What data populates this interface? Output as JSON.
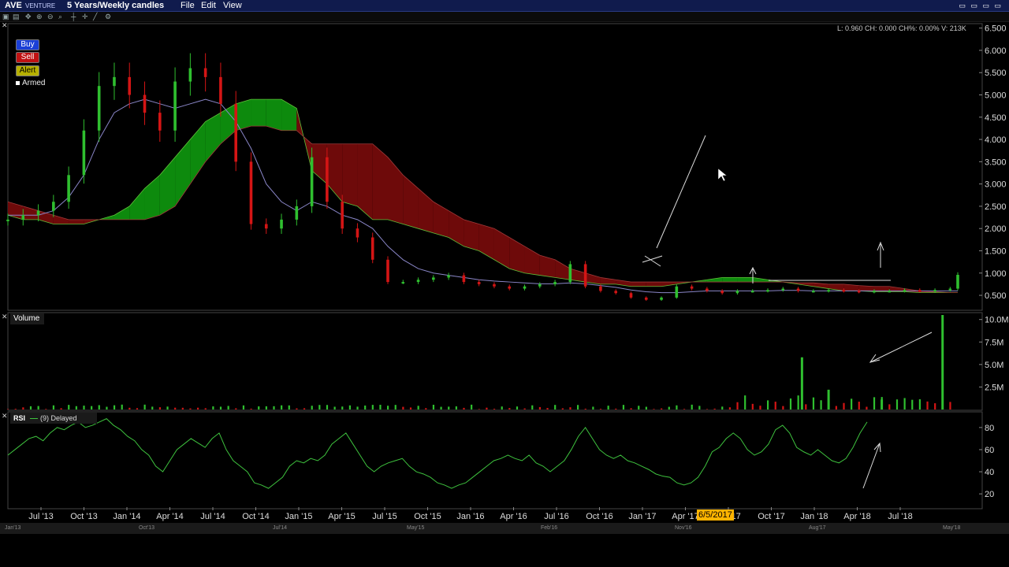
{
  "header": {
    "ticker": "AVE",
    "exchange": "VENTURE",
    "period": "5 Years/Weekly candles",
    "menu": [
      "File",
      "Edit",
      "View"
    ]
  },
  "buttons": {
    "buy": "Buy",
    "sell": "Sell",
    "alert": "Alert",
    "armed": "Armed"
  },
  "info_line": "L: 0.960 CH: 0.000 CH%: 0.00% V: 213K",
  "volume_label": "Volume",
  "rsi_label": {
    "name": "RSI",
    "params": "(9) Delayed"
  },
  "highlight_date": "6/5/2017",
  "bottom_nav": [
    "Jan'13",
    "Oct'13",
    "Jul'14",
    "May'15",
    "Feb'16",
    "Nov'16",
    "Aug'17",
    "May'18"
  ],
  "colors": {
    "up": "#2fbf2f",
    "down": "#d41515",
    "cloud_bull": "#0d8a0d",
    "cloud_bear": "#6e0a0a",
    "ma": "#8a86c8",
    "rsi": "#3ec23e"
  },
  "chart_data": [
    {
      "type": "line",
      "name": "price",
      "x_ticks": [
        "Jul '13",
        "Oct '13",
        "Jan '14",
        "Apr '14",
        "Jul '14",
        "Oct '14",
        "Jan '15",
        "Apr '15",
        "Jul '15",
        "Oct '15",
        "Jan '16",
        "Apr '16",
        "Jul '16",
        "Oct '16",
        "Jan '17",
        "Apr '17",
        "Jul '17",
        "Oct '17",
        "Jan '18",
        "Apr '18",
        "Jul '18"
      ],
      "y_ticks": [
        "0.500",
        "1.000",
        "1.500",
        "2.000",
        "2.500",
        "3.000",
        "3.500",
        "4.000",
        "4.500",
        "5.000",
        "5.500",
        "6.000",
        "6.500"
      ],
      "ylim": [
        0.2,
        6.6
      ],
      "x": [
        0,
        4,
        8,
        12,
        16,
        20,
        24,
        28,
        32,
        36,
        40,
        44,
        48,
        52,
        56,
        60,
        64,
        68,
        72,
        76,
        80,
        84,
        88,
        92,
        96,
        100,
        104,
        108,
        112,
        116,
        120,
        124,
        128,
        132,
        136,
        140,
        144,
        148,
        152,
        156,
        160,
        164,
        168,
        172,
        176,
        180,
        184,
        188,
        192,
        196,
        200,
        204,
        208,
        212,
        216,
        220,
        224,
        228,
        232,
        236,
        240,
        244,
        248,
        250
      ],
      "close": [
        2.2,
        2.3,
        2.4,
        2.6,
        3.2,
        4.2,
        5.2,
        5.4,
        5.0,
        4.6,
        4.2,
        5.3,
        5.6,
        5.4,
        4.8,
        3.5,
        2.1,
        2.0,
        2.2,
        2.5,
        3.6,
        2.6,
        2.0,
        1.8,
        1.3,
        0.8,
        0.8,
        0.85,
        0.9,
        0.95,
        0.8,
        0.75,
        0.7,
        0.65,
        0.7,
        0.75,
        0.8,
        1.2,
        0.7,
        0.6,
        0.55,
        0.45,
        0.4,
        0.45,
        0.7,
        0.65,
        0.6,
        0.55,
        0.6,
        0.6,
        0.62,
        0.65,
        0.6,
        0.6,
        0.62,
        0.6,
        0.58,
        0.6,
        0.6,
        0.62,
        0.6,
        0.62,
        0.65,
        0.96
      ],
      "kijun": [
        2.3,
        2.3,
        2.3,
        2.4,
        2.7,
        3.2,
        4.0,
        4.6,
        4.8,
        4.9,
        4.8,
        4.7,
        4.8,
        4.9,
        4.8,
        4.4,
        3.8,
        3.0,
        2.6,
        2.4,
        2.6,
        2.5,
        2.3,
        2.2,
        2.0,
        1.6,
        1.3,
        1.1,
        1.0,
        0.95,
        0.9,
        0.85,
        0.82,
        0.8,
        0.78,
        0.76,
        0.76,
        0.78,
        0.76,
        0.72,
        0.68,
        0.62,
        0.58,
        0.56,
        0.56,
        0.58,
        0.6,
        0.6,
        0.6,
        0.6,
        0.6,
        0.61,
        0.61,
        0.6,
        0.6,
        0.6,
        0.6,
        0.6,
        0.6,
        0.6,
        0.6,
        0.6,
        0.6,
        0.6
      ],
      "cloud_a": [
        2.3,
        2.2,
        2.2,
        2.1,
        2.1,
        2.1,
        2.2,
        2.3,
        2.5,
        2.9,
        3.2,
        3.6,
        4.0,
        4.4,
        4.6,
        4.8,
        4.9,
        4.9,
        4.9,
        4.7,
        3.3,
        3.0,
        2.6,
        2.5,
        2.2,
        2.2,
        2.1,
        2.0,
        1.9,
        1.8,
        1.6,
        1.5,
        1.3,
        1.1,
        1.0,
        0.95,
        0.9,
        0.85,
        0.8,
        0.75,
        0.75,
        0.7,
        0.7,
        0.7,
        0.75,
        0.8,
        0.85,
        0.9,
        0.9,
        0.9,
        0.85,
        0.8,
        0.75,
        0.7,
        0.65,
        0.6,
        0.6,
        0.58,
        0.58,
        0.58,
        0.56,
        0.56,
        0.56,
        0.56
      ],
      "cloud_b": [
        2.6,
        2.5,
        2.4,
        2.3,
        2.2,
        2.2,
        2.2,
        2.2,
        2.2,
        2.2,
        2.3,
        2.5,
        3.0,
        3.5,
        3.9,
        4.2,
        4.3,
        4.3,
        4.2,
        4.2,
        3.9,
        3.9,
        3.9,
        3.9,
        3.9,
        3.6,
        3.2,
        2.9,
        2.6,
        2.4,
        2.2,
        2.1,
        2.0,
        1.8,
        1.6,
        1.4,
        1.3,
        1.1,
        1.0,
        0.9,
        0.85,
        0.8,
        0.8,
        0.8,
        0.8,
        0.8,
        0.8,
        0.8,
        0.8,
        0.8,
        0.8,
        0.8,
        0.78,
        0.78,
        0.75,
        0.75,
        0.72,
        0.7,
        0.7,
        0.65,
        0.6,
        0.58,
        0.56,
        0.56
      ]
    },
    {
      "type": "bar",
      "name": "volume",
      "y_ticks": [
        "2.5M",
        "5.0M",
        "7.5M",
        "10.0M"
      ],
      "ylim": [
        0,
        10.5
      ],
      "spikes": [
        {
          "x": 209,
          "value": 5.8,
          "color": "up"
        },
        {
          "x": 216,
          "value": 2.2,
          "color": "up"
        },
        {
          "x": 230,
          "value": 1.1,
          "color": "up"
        },
        {
          "x": 246,
          "value": 10.5,
          "color": "up"
        }
      ]
    },
    {
      "type": "line",
      "name": "rsi",
      "y_ticks": [
        "20",
        "40",
        "60",
        "80"
      ],
      "ylim": [
        8,
        92
      ],
      "values": [
        55,
        60,
        65,
        70,
        72,
        68,
        75,
        80,
        78,
        82,
        85,
        80,
        82,
        85,
        88,
        82,
        78,
        72,
        68,
        60,
        55,
        45,
        40,
        50,
        60,
        65,
        70,
        66,
        62,
        70,
        75,
        60,
        50,
        45,
        40,
        30,
        28,
        25,
        30,
        35,
        45,
        50,
        48,
        52,
        50,
        55,
        65,
        70,
        75,
        65,
        55,
        45,
        40,
        45,
        48,
        50,
        52,
        45,
        40,
        38,
        35,
        30,
        28,
        25,
        28,
        30,
        35,
        40,
        45,
        50,
        52,
        55,
        52,
        50,
        55,
        48,
        45,
        40,
        45,
        50,
        60,
        72,
        80,
        70,
        60,
        55,
        52,
        55,
        50,
        48,
        45,
        42,
        38,
        36,
        35,
        30,
        28,
        30,
        35,
        45,
        58,
        62,
        70,
        75,
        70,
        60,
        55,
        58,
        65,
        78,
        82,
        75,
        62,
        58,
        55,
        60,
        55,
        50,
        48,
        52,
        62,
        75,
        85
      ]
    }
  ]
}
